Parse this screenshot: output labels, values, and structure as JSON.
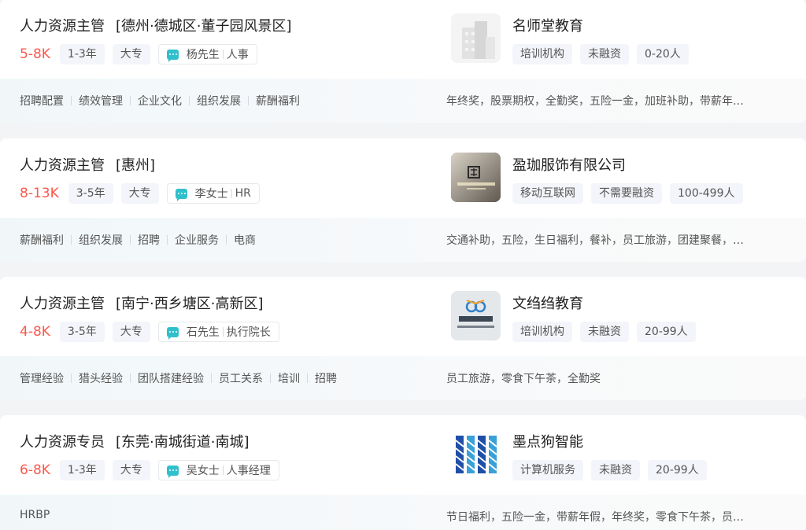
{
  "jobs": [
    {
      "title": "人力资源主管",
      "location": "[德州·德城区·董子园风景区]",
      "salary": "5-8K",
      "experience": "1-3年",
      "education": "大专",
      "recruiter": {
        "name": "杨先生",
        "role": "人事"
      },
      "skills": [
        "招聘配置",
        "绩效管理",
        "企业文化",
        "组织发展",
        "薪酬福利"
      ],
      "company": {
        "name": "名师堂教育",
        "tags": [
          "培训机构",
          "未融资",
          "0-20人"
        ],
        "logo_icon": "building-icon"
      },
      "benefits": "年终奖，股票期权，全勤奖，五险一金，加班补助，带薪年…"
    },
    {
      "title": "人力资源主管",
      "location": "[惠州]",
      "salary": "8-13K",
      "experience": "3-5年",
      "education": "大专",
      "recruiter": {
        "name": "李女士",
        "role": "HR"
      },
      "skills": [
        "薪酬福利",
        "组织发展",
        "招聘",
        "企业服务",
        "电商"
      ],
      "company": {
        "name": "盈珈服饰有限公司",
        "tags": [
          "移动互联网",
          "不需要融资",
          "100-499人"
        ],
        "logo_icon": "company-wall-logo"
      },
      "benefits": "交通补助，五险，生日福利，餐补，员工旅游，团建聚餐，…"
    },
    {
      "title": "人力资源主管",
      "location": "[南宁·西乡塘区·高新区]",
      "salary": "4-8K",
      "experience": "3-5年",
      "education": "大专",
      "recruiter": {
        "name": "石先生",
        "role": "执行院长"
      },
      "skills": [
        "管理经验",
        "猎头经验",
        "团队搭建经验",
        "员工关系",
        "培训",
        "招聘"
      ],
      "company": {
        "name": "文绉绉教育",
        "tags": [
          "培训机构",
          "未融资",
          "20-99人"
        ],
        "logo_icon": "education-sign-logo"
      },
      "benefits": "员工旅游，零食下午茶，全勤奖"
    },
    {
      "title": "人力资源专员",
      "location": "[东莞·南城街道·南城]",
      "salary": "6-8K",
      "experience": "1-3年",
      "education": "大专",
      "recruiter": {
        "name": "吴女士",
        "role": "人事经理"
      },
      "skills": [
        "HRBP"
      ],
      "company": {
        "name": "墨点狗智能",
        "tags": [
          "计算机服务",
          "未融资",
          "20-99人"
        ],
        "logo_icon": "stripes-logo"
      },
      "benefits": "节日福利，五险一金，带薪年假，年终奖，零食下午茶，员…"
    }
  ],
  "colors": {
    "salary": "#fe574a",
    "chat_icon": "#30c0cb",
    "tag_bg": "#f3f5fa"
  }
}
